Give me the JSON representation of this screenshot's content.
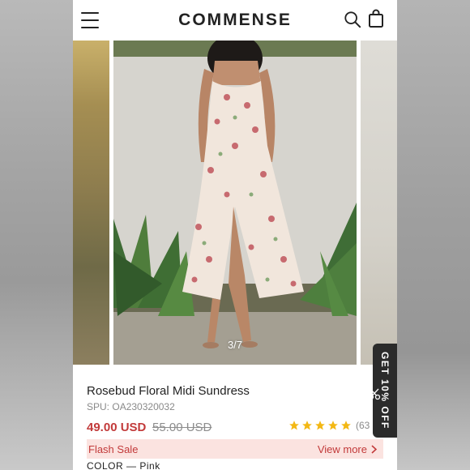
{
  "header": {
    "logo": "COMMENSE",
    "menu_icon": "hamburger-menu-icon",
    "search_icon": "search-icon",
    "bag_icon": "shopping-bag-icon"
  },
  "gallery": {
    "counter": "3/7",
    "current": 3,
    "total": 7
  },
  "product": {
    "title": "Rosebud Floral Midi Sundress",
    "spu_label": "SPU:",
    "spu_value": "OA230320032",
    "price": "49.00 USD",
    "old_price": "55.00 USD",
    "rating_stars": 5,
    "review_count": "(63"
  },
  "flash_sale": {
    "label": "Flash Sale",
    "link": "View more"
  },
  "color": {
    "label": "COLOR",
    "separator": "—",
    "value": "Pink"
  },
  "promo_tab": {
    "label": "GET 10% OFF"
  },
  "colors": {
    "accent_red": "#c23a3a",
    "flash_bg": "#fbe3e0",
    "star_gold": "#f3b814",
    "tab_dark": "#2b2b2b"
  }
}
